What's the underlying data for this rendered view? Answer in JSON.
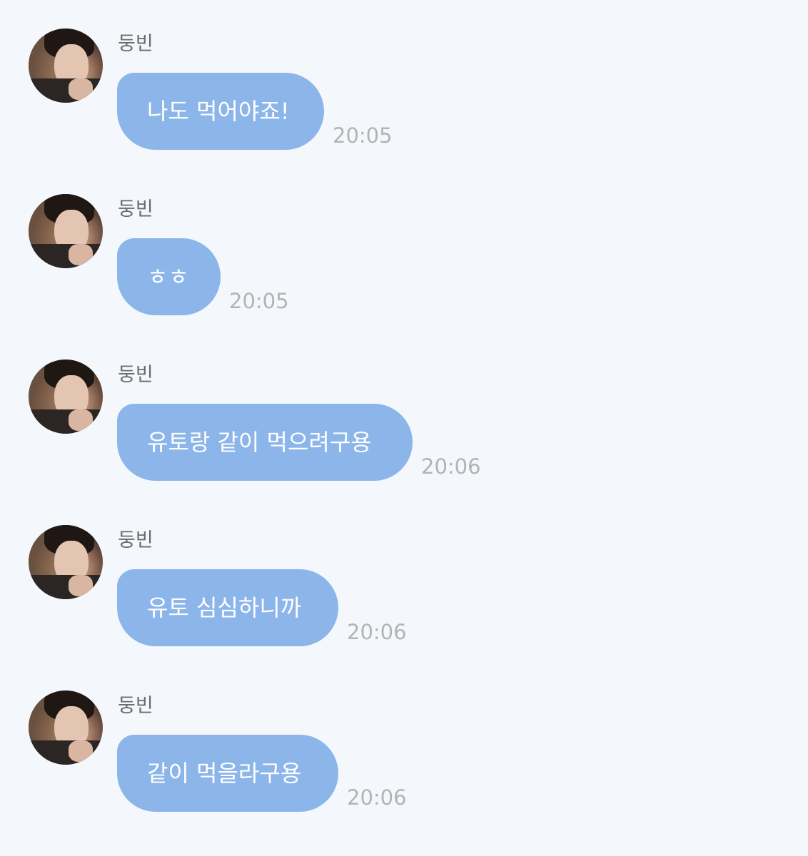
{
  "messages": [
    {
      "sender": "둥빈",
      "text": "나도 먹어야죠!",
      "time": "20:05"
    },
    {
      "sender": "둥빈",
      "text": "ㅎㅎ",
      "time": "20:05"
    },
    {
      "sender": "둥빈",
      "text": "유토랑 같이 먹으려구용",
      "time": "20:06"
    },
    {
      "sender": "둥빈",
      "text": "유토 심심하니까",
      "time": "20:06"
    },
    {
      "sender": "둥빈",
      "text": "같이 먹을라구용",
      "time": "20:06"
    }
  ],
  "colors": {
    "background": "#f4f8fc",
    "bubble": "#8cb5e9",
    "bubble_text": "#ffffff",
    "name_text": "#6b6b6b",
    "time_text": "#b3b3b3"
  }
}
